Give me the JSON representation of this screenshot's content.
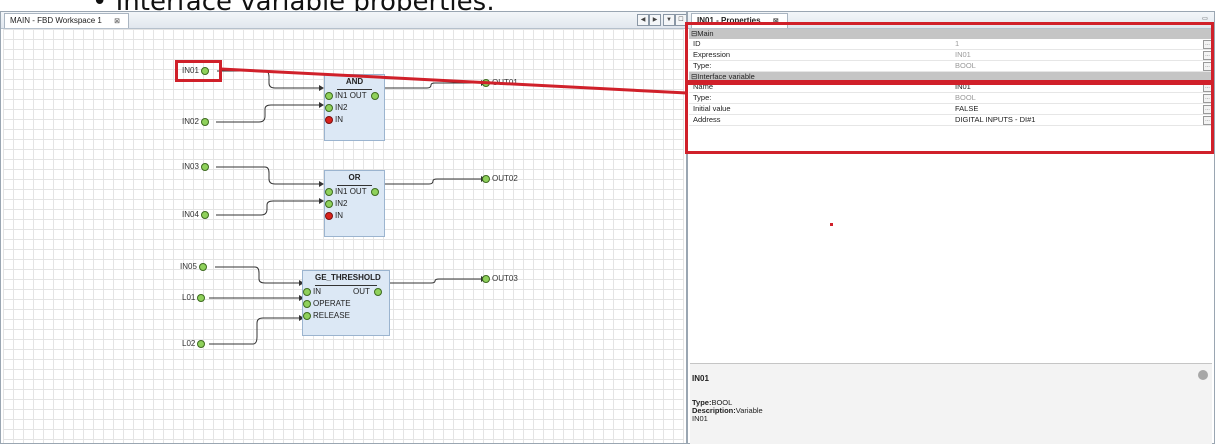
{
  "slide_title": "Interface variable properties:",
  "colors": {
    "highlight": "#d0202a",
    "block_fill": "#dce8f5",
    "connector_ok": "#8fd15b",
    "connector_missing": "#d9221b"
  },
  "editor": {
    "tab_label": "MAIN - FBD Workspace 1",
    "tab_close": "⊠",
    "nav_buttons": [
      "◀",
      "▶",
      "▼",
      "☐"
    ]
  },
  "fbd": {
    "blocks": [
      {
        "name": "AND",
        "inputs": [
          "IN1",
          "IN2",
          "IN"
        ],
        "output": "OUT",
        "missing_input": "IN"
      },
      {
        "name": "OR",
        "inputs": [
          "IN1",
          "IN2",
          "IN"
        ],
        "output": "OUT",
        "missing_input": "IN"
      },
      {
        "name": "GE_THRESHOLD",
        "inputs": [
          "IN",
          "OPERATE",
          "RELEASE"
        ],
        "output": "OUT"
      }
    ],
    "input_vars": [
      "IN01",
      "IN02",
      "IN03",
      "IN04",
      "IN05",
      "L01",
      "L02"
    ],
    "output_vars": [
      "OUT01",
      "OUT02",
      "OUT03"
    ]
  },
  "properties": {
    "tab_label": "IN01 - Properties",
    "tab_close": "⊠",
    "minimize": "▭",
    "groups": [
      {
        "title": "Main",
        "rows": [
          {
            "key": "ID",
            "value": "1"
          },
          {
            "key": "Expression",
            "value": "IN01"
          },
          {
            "key": "Type:",
            "value": "BOOL"
          }
        ]
      },
      {
        "title": "Interface variable",
        "rows": [
          {
            "key": "Name",
            "value": "IN01"
          },
          {
            "key": "Type:",
            "value": "BOOL"
          },
          {
            "key": "Initial value",
            "value": "FALSE"
          },
          {
            "key": "Address",
            "value": "DIGITAL INPUTS - DI#1"
          }
        ]
      }
    ],
    "collapse_glyph": "⊟",
    "edit_glyph": "…",
    "description": {
      "title": "IN01",
      "type_label": "Type:",
      "type_value": "BOOL",
      "desc_label": "Description:",
      "desc_value": "Variable",
      "name_line": "IN01"
    }
  }
}
